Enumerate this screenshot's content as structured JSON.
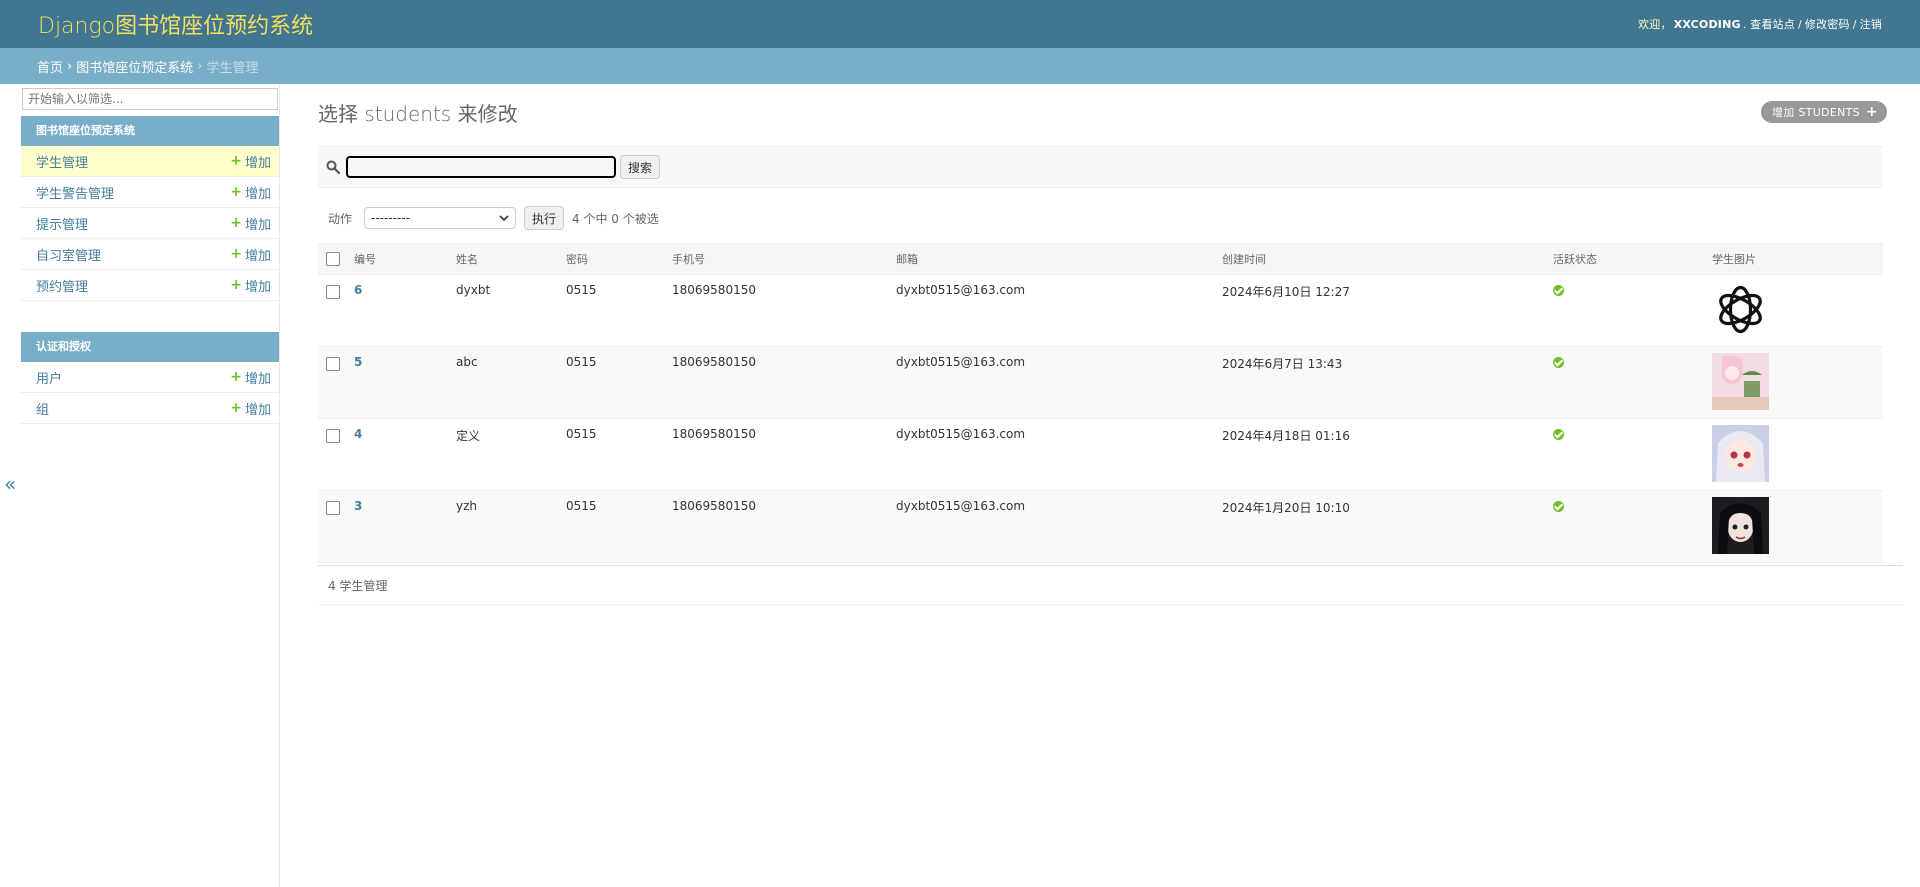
{
  "header": {
    "site_name": "Django图书馆座位预约系统",
    "welcome": "欢迎，",
    "username": "XXCODING",
    "view_site": "查看站点",
    "change_password": "修改密码",
    "logout": "注销"
  },
  "breadcrumbs": {
    "home": "首页",
    "app": "图书馆座位预定系统",
    "current": "学生管理"
  },
  "sidebar": {
    "filter_placeholder": "开始输入以筛选...",
    "add_label": "增加",
    "modules": [
      {
        "caption": "图书馆座位预定系统",
        "items": [
          {
            "label": "学生管理"
          },
          {
            "label": "学生警告管理"
          },
          {
            "label": "提示管理"
          },
          {
            "label": "自习室管理"
          },
          {
            "label": "预约管理"
          }
        ]
      },
      {
        "caption": "认证和授权",
        "items": [
          {
            "label": "用户"
          },
          {
            "label": "组"
          }
        ]
      }
    ],
    "toggle": "«"
  },
  "content": {
    "title": "选择 students 来修改",
    "add_button": "增加 STUDENTS",
    "search_button": "搜索",
    "action_label": "动作",
    "action_selected": "---------",
    "go_button": "执行",
    "selection_counter": "4 个中 0 个被选",
    "columns": [
      "编号",
      "姓名",
      "密码",
      "手机号",
      "邮箱",
      "创建时间",
      "活跃状态",
      "学生图片"
    ],
    "rows": [
      {
        "id": "6",
        "name": "dyxbt",
        "password": "0515",
        "phone": "18069580150",
        "email": "dyxbt0515@163.com",
        "created": "2024年6月10日 12:27",
        "active": true,
        "image": "logo-knot"
      },
      {
        "id": "5",
        "name": "abc",
        "password": "0515",
        "phone": "18069580150",
        "email": "dyxbt0515@163.com",
        "created": "2024年6月7日 13:43",
        "active": true,
        "image": "anime-girl-pink"
      },
      {
        "id": "4",
        "name": "定义",
        "password": "0515",
        "phone": "18069580150",
        "email": "dyxbt0515@163.com",
        "created": "2024年4月18日 01:16",
        "active": true,
        "image": "anime-girl-white-hair"
      },
      {
        "id": "3",
        "name": "yzh",
        "password": "0515",
        "phone": "18069580150",
        "email": "dyxbt0515@163.com",
        "created": "2024年1月20日 10:10",
        "active": true,
        "image": "anime-girl-dark"
      }
    ],
    "paginator": "4 学生管理"
  },
  "colors": {
    "header": "#417690",
    "breadcrumbs": "#79aec8",
    "accent": "#f5dd5d",
    "link": "#447e9b",
    "add": "#70bf2b"
  }
}
